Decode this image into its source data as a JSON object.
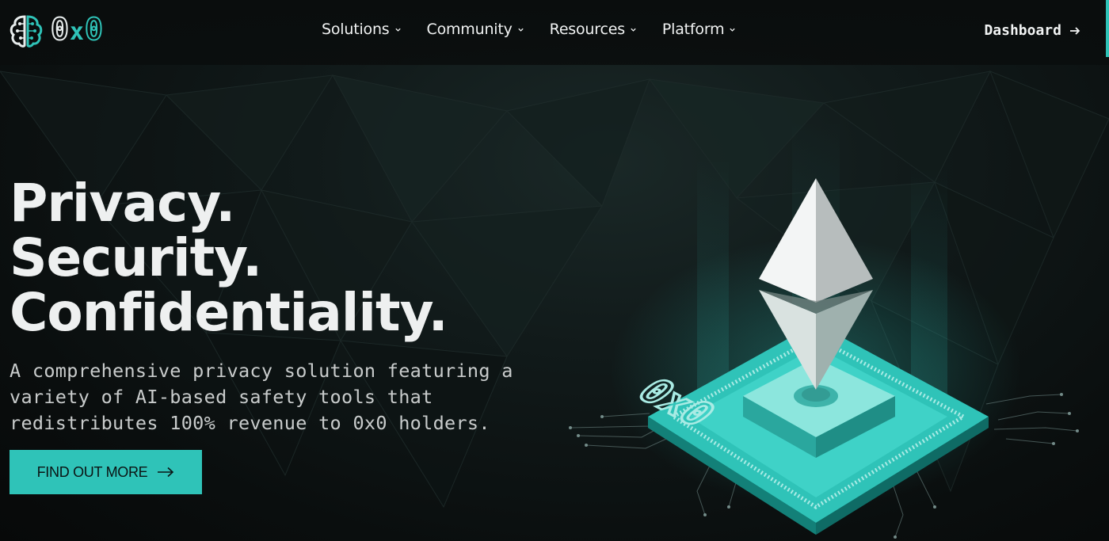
{
  "brand": {
    "wordmark_left": "0",
    "wordmark_mid": "x",
    "wordmark_right": "0",
    "accent_color": "#2fc3b8",
    "logo_icon": "brain-icon"
  },
  "nav": {
    "items": [
      {
        "label": "Solutions",
        "icon": "chevron-down-icon"
      },
      {
        "label": "Community",
        "icon": "chevron-down-icon"
      },
      {
        "label": "Resources",
        "icon": "chevron-down-icon"
      },
      {
        "label": "Platform",
        "icon": "chevron-down-icon"
      }
    ],
    "dashboard_label": "Dashboard",
    "dashboard_icon": "arrow-right-icon"
  },
  "hero": {
    "title_lines": [
      "Privacy.",
      "Security.",
      "Confidentiality."
    ],
    "subtitle": "A comprehensive privacy solution featuring a variety of AI-based safety tools that redistributes 100% revenue to 0x0 holders.",
    "cta_label": "FIND OUT MORE",
    "cta_icon": "arrow-right-icon"
  },
  "illustration": {
    "chip_label": "0x0",
    "crystal_icon": "ethereum-diamond-icon",
    "chip_icon": "processor-chip-icon"
  }
}
